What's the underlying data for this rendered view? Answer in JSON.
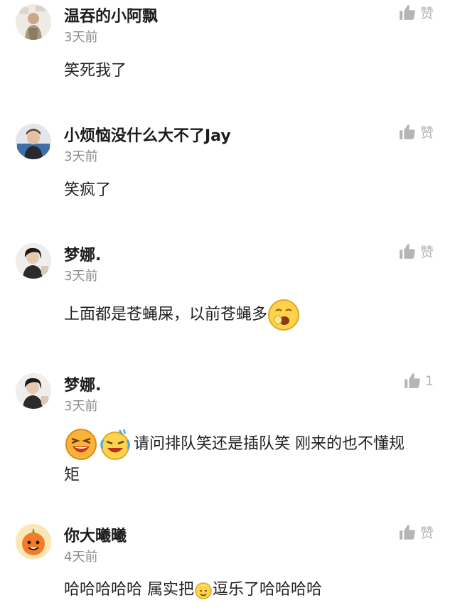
{
  "comments": [
    {
      "username": "温吞的小阿飘",
      "time": "3天前",
      "like_text": "赞",
      "content": [
        "笑死我了"
      ],
      "avatar_icon": "child-photo-avatar"
    },
    {
      "username": "小烦恼没什么大不了Jay",
      "time": "3天前",
      "like_text": "赞",
      "content": [
        "笑疯了"
      ],
      "avatar_icon": "man-photo-avatar"
    },
    {
      "username": "梦娜.",
      "time": "3天前",
      "like_text": "赞",
      "content": [
        "上面都是苍蝇屎，以前苍蝇多"
      ],
      "emoji_after": "yawn-face-emoji",
      "avatar_icon": "woman-photo-avatar"
    },
    {
      "username": "梦娜.",
      "time": "3天前",
      "like_text": "1",
      "content": [
        "请问排队笑还是插队笑 刚来的也不懂规",
        "矩"
      ],
      "emoji_before": [
        "laughing-face-emoji",
        "rolling-laugh-emoji"
      ],
      "avatar_icon": "woman-photo-avatar"
    },
    {
      "username": "你大曦曦",
      "time": "4天前",
      "like_text": "赞",
      "content": [
        "哈哈哈哈哈 属实把",
        "逗乐了哈哈哈哈"
      ],
      "emoji_inline": "grandpa-face-emoji",
      "avatar_icon": "orange-mascot-avatar"
    }
  ],
  "colors": {
    "username": "#1c1c1c",
    "timestamp": "#8c8c8c",
    "like_icon": "#b5b5b5",
    "body_text": "#1f1f1f",
    "background": "#ffffff"
  }
}
